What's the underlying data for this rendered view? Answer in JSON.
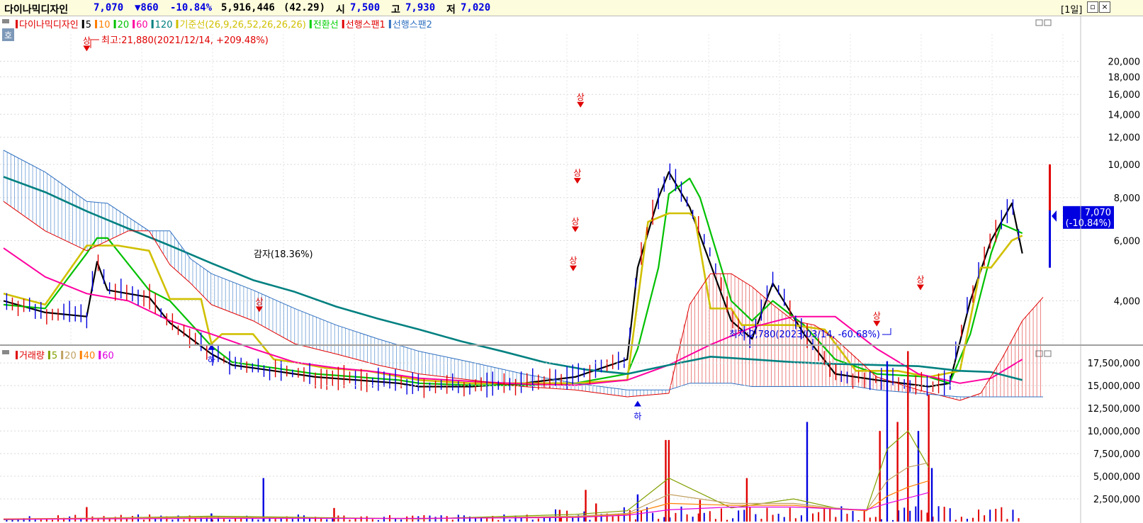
{
  "header": {
    "stock_name": "다이나믹디자인",
    "price": "7,070",
    "change": "▼860",
    "change_pct": "-10.84%",
    "volume": "5,916,446",
    "volume_ratio": "(42.29)",
    "open_label": "시",
    "open": "7,500",
    "high_label": "고",
    "high": "7,930",
    "low_label": "저",
    "low": "7,020",
    "period": "[1일]",
    "colors": {
      "up": "#e00000",
      "down": "#0000e0",
      "text": "#000000"
    }
  },
  "price_panel": {
    "legend": [
      {
        "label": "다이나믹디자인",
        "color": "#e00000"
      },
      {
        "label": "5",
        "color": "#000000"
      },
      {
        "label": "10",
        "color": "#ff7f00"
      },
      {
        "label": "20",
        "color": "#00c000"
      },
      {
        "label": "60",
        "color": "#ff00a0"
      },
      {
        "label": "120",
        "color": "#008080"
      },
      {
        "label": "기준선(26,9,26,52,26,26,26)",
        "color": "#d0c000"
      },
      {
        "label": "전환선",
        "color": "#00d000"
      },
      {
        "label": "선행스팬1",
        "color": "#e00000"
      },
      {
        "label": "선행스팬2",
        "color": "#3070c0"
      }
    ],
    "corner_label": "호",
    "high_annotation": "최고:21,880(2021/12/14, +209.48%)",
    "low_annotation": "최저:2,780(2023/03/14, -60.68%)",
    "overlap_text": "감자(18.36%)",
    "current_price_tag": {
      "price": "7,070",
      "pct": "(-10.84%)",
      "value": 7070
    },
    "signal_up": "상",
    "signal_down": "하"
  },
  "volume_panel": {
    "legend": [
      {
        "label": "거래량",
        "color": "#e00000"
      },
      {
        "label": "5",
        "color": "#80a000"
      },
      {
        "label": "20",
        "color": "#c0a060"
      },
      {
        "label": "40",
        "color": "#ff7f00"
      },
      {
        "label": "60",
        "color": "#e000e0"
      }
    ]
  },
  "chart_data": [
    {
      "type": "line",
      "title": "다이나믹디자인",
      "y_scale": "log",
      "ylim": [
        3000,
        24000
      ],
      "yticks": [
        4000,
        6000,
        8000,
        10000,
        12000,
        14000,
        16000,
        18000,
        20000
      ],
      "ytick_labels": [
        "4,000",
        "6,000",
        "8,000",
        "10,000",
        "12,000",
        "14,000",
        "16,000",
        "18,000",
        "20,000"
      ],
      "x_index_range": [
        0,
        100
      ],
      "series": [
        {
          "name": "5",
          "color": "#000000",
          "x": [
            0,
            4,
            8,
            9,
            10,
            14,
            16,
            20,
            22,
            24,
            26,
            30,
            34,
            38,
            40,
            45,
            50,
            55,
            60,
            61,
            63,
            64,
            66,
            70,
            72,
            74,
            77,
            80,
            84,
            89,
            91,
            93,
            95,
            97,
            98
          ],
          "y": [
            4000,
            3700,
            3600,
            5200,
            4300,
            4100,
            3450,
            2800,
            2600,
            2550,
            2500,
            2400,
            2350,
            2300,
            2250,
            2250,
            2300,
            2400,
            2700,
            5000,
            8000,
            9500,
            7500,
            3500,
            3100,
            4500,
            3200,
            2450,
            2350,
            2250,
            2300,
            4000,
            6000,
            7700,
            5500
          ]
        },
        {
          "name": "20",
          "color": "#00c000",
          "x": [
            0,
            4,
            8,
            9,
            10,
            14,
            16,
            20,
            22,
            24,
            26,
            30,
            34,
            38,
            40,
            45,
            50,
            55,
            60,
            61,
            63,
            64,
            66,
            67,
            70,
            72,
            74,
            77,
            80,
            84,
            89,
            91,
            93,
            95,
            96,
            97,
            98
          ],
          "y": [
            3900,
            3800,
            5500,
            6100,
            6100,
            4300,
            4000,
            2950,
            2650,
            2600,
            2550,
            2450,
            2400,
            2350,
            2300,
            2270,
            2270,
            2300,
            2450,
            2900,
            5000,
            8200,
            9100,
            8000,
            4000,
            3500,
            4000,
            3400,
            2700,
            2450,
            2400,
            2300,
            3200,
            5500,
            6700,
            6500,
            6300
          ]
        },
        {
          "name": "기준선",
          "color": "#d0c000",
          "x": [
            0,
            4,
            8,
            11,
            14,
            16,
            19,
            20,
            21,
            24,
            26,
            28,
            31,
            35,
            40,
            45,
            50,
            55,
            60,
            62,
            64,
            66,
            66.5,
            68,
            70,
            71,
            74,
            76,
            79,
            82,
            86,
            89,
            92,
            94,
            95,
            97,
            98
          ],
          "y": [
            4200,
            3900,
            5800,
            5800,
            5600,
            4050,
            4050,
            3000,
            3200,
            3200,
            2700,
            2650,
            2550,
            2500,
            2350,
            2300,
            2300,
            2300,
            2350,
            6800,
            7200,
            7200,
            7000,
            3800,
            3800,
            3400,
            3400,
            3400,
            3300,
            2500,
            2500,
            2400,
            2500,
            5000,
            5000,
            6000,
            6200
          ]
        },
        {
          "name": "60",
          "color": "#ff00a0",
          "x": [
            0,
            4,
            8,
            12,
            16,
            20,
            24,
            28,
            32,
            36,
            40,
            45,
            50,
            55,
            60,
            64,
            68,
            72,
            76,
            80,
            84,
            88,
            92,
            95,
            98
          ],
          "y": [
            5700,
            4700,
            4200,
            4000,
            3500,
            3200,
            2900,
            2650,
            2550,
            2480,
            2380,
            2330,
            2290,
            2270,
            2350,
            2600,
            2980,
            3350,
            3600,
            3600,
            2900,
            2450,
            2300,
            2380,
            2700
          ]
        },
        {
          "name": "120",
          "color": "#008080",
          "x": [
            0,
            4,
            8,
            12,
            16,
            20,
            24,
            28,
            32,
            36,
            40,
            44,
            48,
            52,
            56,
            60,
            64,
            68,
            72,
            76,
            80,
            84,
            88,
            92,
            95,
            98
          ],
          "y": [
            9200,
            8300,
            7300,
            6500,
            5800,
            5150,
            4600,
            4250,
            3850,
            3550,
            3300,
            3050,
            2850,
            2650,
            2520,
            2450,
            2600,
            2750,
            2700,
            2650,
            2620,
            2600,
            2580,
            2500,
            2480,
            2350
          ]
        },
        {
          "name": "선행스팬1",
          "color": "#e00000",
          "x": [
            0,
            4,
            8,
            12,
            14,
            16,
            18,
            20,
            24,
            28,
            32,
            36,
            40,
            45,
            50,
            55,
            60,
            64,
            66,
            68,
            70,
            72,
            74,
            76,
            78,
            80,
            84,
            88,
            92,
            94,
            96,
            98,
            100
          ],
          "y": [
            7800,
            6400,
            5600,
            6400,
            6400,
            5100,
            4500,
            3900,
            3500,
            3000,
            2800,
            2600,
            2450,
            2350,
            2250,
            2200,
            2100,
            2150,
            3900,
            4800,
            4800,
            4400,
            3900,
            3500,
            3400,
            3100,
            2400,
            2200,
            2050,
            2150,
            2700,
            3500,
            4100
          ]
        },
        {
          "name": "선행스팬2",
          "color": "#3070c0",
          "x": [
            0,
            4,
            8,
            10,
            14,
            16,
            18,
            20,
            24,
            28,
            32,
            36,
            40,
            45,
            50,
            55,
            60,
            62,
            64,
            66,
            68,
            70,
            72,
            74,
            76,
            78,
            80,
            82,
            84,
            88,
            92,
            94,
            96,
            98,
            100
          ],
          "y": [
            11000,
            9500,
            7800,
            7700,
            6400,
            6400,
            5300,
            4800,
            4300,
            3800,
            3400,
            3100,
            2850,
            2650,
            2450,
            2300,
            2200,
            2200,
            2200,
            2300,
            2300,
            2300,
            2250,
            2250,
            2250,
            2250,
            2250,
            2250,
            2200,
            2150,
            2100,
            2100,
            2100,
            2100,
            2100
          ]
        }
      ],
      "signals": [
        {
          "label": "상",
          "x": 8,
          "y": 21880
        },
        {
          "label": "하",
          "x": 20,
          "y": 2850
        },
        {
          "label": "상",
          "x": 24.6,
          "y": 3800
        },
        {
          "label": "상",
          "x": 55.5,
          "y": 15000
        },
        {
          "label": "상",
          "x": 55.2,
          "y": 9000
        },
        {
          "label": "상",
          "x": 55,
          "y": 6500
        },
        {
          "label": "상",
          "x": 54.8,
          "y": 5000
        },
        {
          "label": "하",
          "x": 61,
          "y": 1950
        },
        {
          "label": "상",
          "x": 84,
          "y": 3450
        },
        {
          "label": "상",
          "x": 88.2,
          "y": 4400
        }
      ]
    },
    {
      "type": "bar",
      "title": "거래량",
      "ylim": [
        0,
        19000000
      ],
      "yticks": [
        2500000,
        5000000,
        7500000,
        10000000,
        12500000,
        15000000,
        17500000
      ],
      "ytick_labels": [
        "2,500,000",
        "5,000,000",
        "7,500,000",
        "10,000,000",
        "12,500,000",
        "15,000,000",
        "17,500,000"
      ],
      "bars": [
        {
          "x": 8,
          "value": 1600000,
          "up": true
        },
        {
          "x": 20,
          "value": 900000,
          "up": false
        },
        {
          "x": 25,
          "value": 4800000,
          "up": false
        },
        {
          "x": 31.8,
          "value": 1500000,
          "up": true
        },
        {
          "x": 53.5,
          "value": 1300000,
          "up": true
        },
        {
          "x": 56,
          "value": 3500000,
          "up": true
        },
        {
          "x": 57,
          "value": 2000000,
          "up": true
        },
        {
          "x": 61,
          "value": 3000000,
          "up": false
        },
        {
          "x": 63.7,
          "value": 9000000,
          "up": true
        },
        {
          "x": 64,
          "value": 9000000,
          "up": true
        },
        {
          "x": 67,
          "value": 2400000,
          "up": true
        },
        {
          "x": 71.5,
          "value": 4800000,
          "up": true
        },
        {
          "x": 77.3,
          "value": 11000000,
          "up": false
        },
        {
          "x": 84.3,
          "value": 10000000,
          "up": true
        },
        {
          "x": 85,
          "value": 17700000,
          "up": false
        },
        {
          "x": 86,
          "value": 11000000,
          "up": true
        },
        {
          "x": 87,
          "value": 18800000,
          "up": true
        },
        {
          "x": 88,
          "value": 10000000,
          "up": false
        },
        {
          "x": 89,
          "value": 14000000,
          "up": true
        },
        {
          "x": 89.3,
          "value": 5900000,
          "up": false
        }
      ],
      "series": [
        {
          "name": "5",
          "color": "#80a000",
          "x": [
            0,
            20,
            40,
            55,
            60,
            64,
            70,
            76,
            80,
            83,
            85,
            87,
            89
          ],
          "y": [
            200000,
            600000,
            300000,
            800000,
            1200000,
            4800000,
            1500000,
            2500000,
            1500000,
            1200000,
            8000000,
            10000000,
            6000000
          ]
        },
        {
          "name": "20",
          "color": "#c0a060",
          "x": [
            0,
            20,
            40,
            55,
            60,
            64,
            70,
            76,
            80,
            83,
            85,
            87,
            89
          ],
          "y": [
            300000,
            500000,
            300000,
            600000,
            900000,
            3000000,
            2000000,
            2000000,
            1500000,
            1200000,
            4500000,
            6000000,
            6500000
          ]
        },
        {
          "name": "40",
          "color": "#ff7f00",
          "x": [
            0,
            20,
            40,
            55,
            60,
            64,
            70,
            76,
            80,
            83,
            85,
            87,
            89
          ],
          "y": [
            300000,
            400000,
            350000,
            500000,
            800000,
            2000000,
            1800000,
            1800000,
            1400000,
            1200000,
            2800000,
            3800000,
            4500000
          ]
        },
        {
          "name": "60",
          "color": "#e000e0",
          "x": [
            0,
            20,
            40,
            55,
            60,
            64,
            70,
            76,
            80,
            83,
            85,
            87,
            89
          ],
          "y": [
            250000,
            350000,
            350000,
            450000,
            700000,
            1300000,
            1600000,
            1600000,
            1400000,
            1300000,
            2000000,
            2600000,
            3200000
          ]
        }
      ]
    }
  ]
}
